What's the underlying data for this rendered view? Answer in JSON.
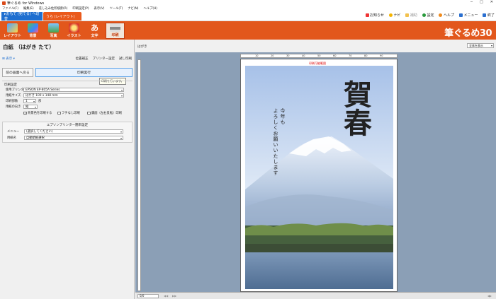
{
  "window": {
    "title": "筆ぐるめ for Windows"
  },
  "menu": [
    "ファイル(F)",
    "編集(E)",
    "差し込み住所検索(R)",
    "印刷設定(P)",
    "表示(V)",
    "ツール(T)",
    "ナビ(N)",
    "ヘルプ(H)"
  ],
  "tabs": {
    "omote": "▸おもて (宛てる) へ切替",
    "ura": "うら (レイアウト)"
  },
  "helpbar": {
    "notice": "お知らせ",
    "navi": "ナビ",
    "assist": "補助",
    "settings": "設定",
    "help": "ヘルプ",
    "menu": "メニュー",
    "exit": "終了"
  },
  "toolbar": {
    "items": [
      "レイアウト",
      "背景",
      "写真",
      "イラスト",
      "文字",
      "印刷"
    ],
    "brand": "筆ぐるめ30"
  },
  "panel": {
    "title": "白紙 （はがき たて）",
    "display_label": "表示",
    "links": [
      "位置補正",
      "プリンター設定",
      "試し印刷"
    ],
    "back_button": "前の画面へ戻る",
    "print_button": "印刷実行",
    "tooltip": "印刷を行います。",
    "settings_head": "印刷設定",
    "printer_label": "使用プリンター",
    "printer_value": "EPSON EP-805A Series",
    "paper_label": "用紙サイズ",
    "paper_value": "はがき 100 x 148 mm",
    "copies_label": "印刷部数",
    "copies_value": "1",
    "copies_unit": "部",
    "orient_label": "用紙の向き",
    "orient_value": "縦",
    "chk_bg": "背景色を印刷する",
    "chk_borderless": "フチなし印刷",
    "chk_mirror": "鏡面（左右反転）印刷",
    "epson_head": "エプソンプリンター簡単設定",
    "epson_menu_label": "メニュー",
    "epson_menu_value": "(選択してください)",
    "epson_paper_label": "用紙名",
    "epson_paper_value": "自動給紙選択"
  },
  "preview": {
    "label": "はがき",
    "zoom": "全体を表示",
    "print_range": "印刷可能範囲",
    "ruler": [
      "10",
      "20",
      "30",
      "40",
      "50",
      "60",
      "70",
      "80",
      "90"
    ],
    "greeting": "賀春",
    "message_col1": "今年も",
    "message_col2": "よろしくお願いいたします",
    "page_indicator": "0/0"
  },
  "colors": {
    "accent": "#e2571c",
    "blue": "#1f6fd0",
    "preview_bg": "#8b9fb6"
  }
}
